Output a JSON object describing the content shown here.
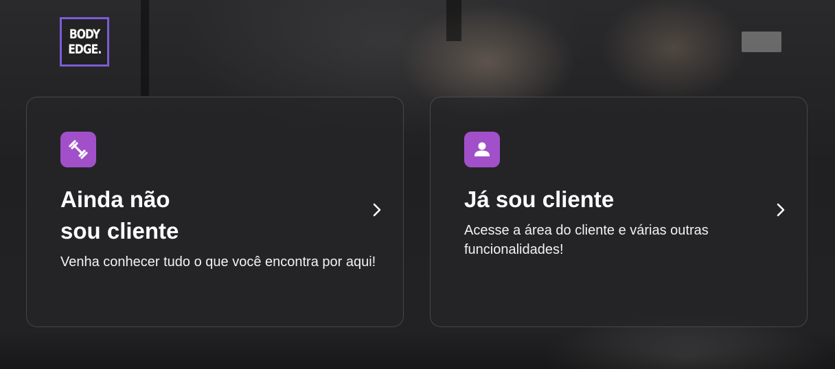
{
  "brand": {
    "logo_line1": "BODY",
    "logo_line2": "EDGE.",
    "accent_color": "#7c5cd6",
    "icon_tile_color": "#a150c9"
  },
  "cards": [
    {
      "id": "not-client",
      "icon": "dumbbell-icon",
      "title_line1": "Ainda não",
      "title_line2": "sou cliente",
      "description": "Venha conhecer tudo o que você encontra por aqui!",
      "chevron": "chevron-right-icon"
    },
    {
      "id": "already-client",
      "icon": "user-icon",
      "title_line1": "Já sou cliente",
      "description": "Acesse a área do cliente e várias outras funcionalidades!",
      "chevron": "chevron-right-icon"
    }
  ]
}
